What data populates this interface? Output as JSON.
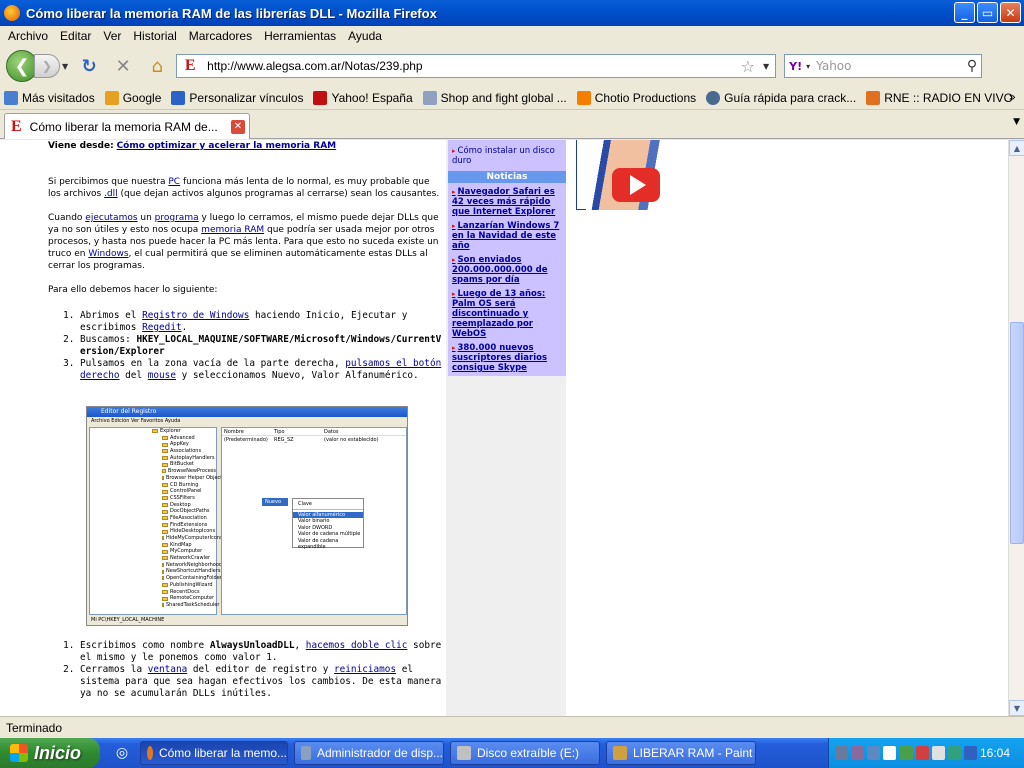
{
  "window": {
    "title": "Cómo liberar la memoria RAM de las librerías DLL - Mozilla Firefox",
    "minimize": "_",
    "maximize": "▭",
    "close": "✕"
  },
  "menu": [
    "Archivo",
    "Editar",
    "Ver",
    "Historial",
    "Marcadores",
    "Herramientas",
    "Ayuda"
  ],
  "nav": {
    "url": "http://www.alegsa.com.ar/Notas/239.php",
    "search_placeholder": "Yahoo",
    "search_engine": "Y!"
  },
  "bookmarks": [
    {
      "label": "Más visitados",
      "icon": "folder-icon",
      "color": "#4a7fd0"
    },
    {
      "label": "Google",
      "icon": "google-icon",
      "color": "#e8a020"
    },
    {
      "label": "Personalizar vínculos",
      "icon": "msn-icon",
      "color": "#2a62c8"
    },
    {
      "label": "Yahoo! España",
      "icon": "yahoo-icon",
      "color": "#c01010"
    },
    {
      "label": "Shop and fight global ...",
      "icon": "page-icon",
      "color": "#8fa0c0"
    },
    {
      "label": "Chotio Productions",
      "icon": "blogger-icon",
      "color": "#f57d00"
    },
    {
      "label": "Guía rápida para crack...",
      "icon": "wordpress-icon",
      "color": "#4a6a90"
    },
    {
      "label": "RNE :: RADIO EN VIVO",
      "icon": "rtve-icon",
      "color": "#e07020"
    }
  ],
  "bookmarks_more": "»",
  "tab": {
    "title": "Cómo liberar la memoria RAM de...",
    "icon": "E"
  },
  "article": {
    "viene_label": "Viene desde:",
    "viene_link": "Cómo optimizar y acelerar la memoria RAM",
    "p1_a": "Si percibimos que nuestra ",
    "p1_pc": "PC",
    "p1_b": " funciona más lenta de lo normal, es muy probable que los archivos ",
    "p1_dll": ".dll",
    "p1_c": " (que dejan activos algunos programas al cerrarse) sean los causantes.",
    "p2_a": "Cuando ",
    "p2_ejecutamos": "ejecutamos",
    "p2_b": " un ",
    "p2_programa": "programa",
    "p2_c": " y luego lo cerramos, el mismo puede dejar DLLs que ya no son útiles y esto nos ocupa ",
    "p2_ram": "memoria RAM",
    "p2_d": " que podría ser usada mejor por otros procesos, y hasta nos puede hacer la PC más lenta. Para que esto no suceda existe un truco en ",
    "p2_windows": "Windows",
    "p2_e": ", el cual permitirá que se eliminen automáticamente estas DLLs al cerrar los programas.",
    "p3": "Para ello debemos hacer lo siguiente:",
    "step1_a": "Abrimos el ",
    "step1_reg": "Registro de Windows",
    "step1_b": " haciendo Inicio, Ejecutar y escribimos ",
    "step1_regedit": "Regedit",
    "step1_c": ".",
    "step2_a": "Buscamos: ",
    "step2_key": "HKEY_LOCAL_MAQUINE/SOFTWARE/Microsoft/Windows/CurrentVersion/Explorer",
    "step3_a": "Pulsamos en la zona vacía de la parte derecha, ",
    "step3_link1": "pulsamos el botón derecho",
    "step3_b": " del ",
    "step3_mouse": "mouse",
    "step3_c": " y seleccionamos Nuevo, Valor Alfanumérico.",
    "step4_a": "Escribimos como nombre ",
    "step4_name": "AlwaysUnloadDLL",
    "step4_b": ", ",
    "step4_link": "hacemos doble clic",
    "step4_c": " sobre el mismo y le ponemos como valor 1.",
    "step5_a": "Cerramos la ",
    "step5_ventana": "ventana",
    "step5_b": " del editor de registro y ",
    "step5_reiniciamos": "reiniciamos",
    "step5_c": " el sistema para que sea hagan efectivos los cambios. De esta manera ya no se acumularán DLLs inútiles."
  },
  "regedit": {
    "title": "Editor del Registro",
    "menu": "Archivo   Edición   Ver   Favoritos   Ayuda",
    "tree": [
      "Explorer",
      "Advanced",
      "AppKey",
      "Associations",
      "AutoplayHandlers",
      "BitBucket",
      "BrowseNewProcess",
      "Browser Helper Objects",
      "CD Burning",
      "ControlPanel",
      "CSSFilters",
      "Desktop",
      "DocObjectPaths",
      "FileAssociation",
      "FindExtensions",
      "HideDesktopIcons",
      "HideMyComputerIcons",
      "KindMap",
      "MyComputer",
      "NetworkCrawler",
      "NetworkNeighborhood",
      "NewShortcutHandlers",
      "OpenContainingFolderH",
      "PublishingWizard",
      "RecentDocs",
      "RemoteComputer",
      "SharedTaskScheduler"
    ],
    "headers": [
      "Nombre",
      "Tipo",
      "Datos"
    ],
    "row": [
      "(Predeterminado)",
      "REG_SZ",
      "(valor no establecido)"
    ],
    "ctx_nuevo": "Nuevo",
    "ctx_items": [
      "Clave",
      "Valor alfanumérico",
      "Valor binario",
      "Valor DWORD",
      "Valor de cadena múltiple",
      "Valor de cadena expandible"
    ],
    "status": "Mi PC\\HKEY_LOCAL_MACHINE"
  },
  "sidebar": {
    "top_link": "Cómo instalar un disco duro",
    "header": "Noticias",
    "news": [
      "Navegador Safari es 42 veces más rápido que Internet Explorer",
      "Lanzarían Windows 7 en la Navidad de este año",
      "Son enviados 200.000.000.000 de spams por día",
      "Luego de 13 años: Palm OS será discontinuado y reemplazado por WebOS",
      "380.000 nuevos suscriptores diarios consigue Skype"
    ]
  },
  "status": "Terminado",
  "taskbar": {
    "start": "Inicio",
    "tasks": [
      {
        "label": "Cómo liberar la memo...",
        "color": "#e07a20"
      },
      {
        "label": "Administrador de disp...",
        "color": "#8aa0c0"
      },
      {
        "label": "Disco extraíble (E:)",
        "color": "#c0c0c0"
      },
      {
        "label": "LIBERAR RAM - Paint",
        "color": "#d0a040"
      }
    ],
    "clock": "16:04"
  }
}
